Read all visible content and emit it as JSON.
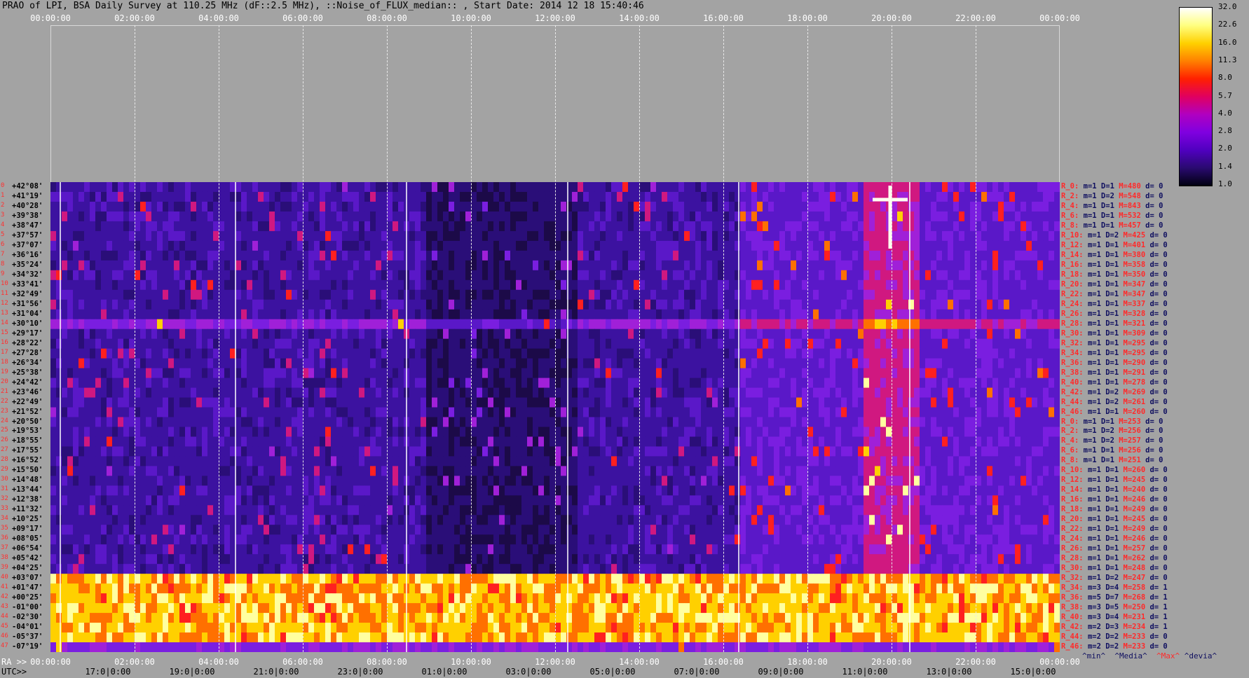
{
  "title": "PRAO of LPI, BSA Daily Survey at 110.25 MHz (dF::2.5 MHz), ::Noise_of_FLUX_median:: , Start Date: 2014 12 18 15:40:46",
  "top_axis": [
    "00:00:00",
    "02:00:00",
    "04:00:00",
    "06:00:00",
    "08:00:00",
    "10:00:00",
    "12:00:00",
    "14:00:00",
    "16:00:00",
    "18:00:00",
    "20:00:00",
    "22:00:00",
    "00:00:00"
  ],
  "bottom_axis": {
    "ra_prefix": "RA >>",
    "ra_labels": [
      "00:00:00",
      "02:00:00",
      "04:00:00",
      "06:00:00",
      "08:00:00",
      "10:00:00",
      "12:00:00",
      "14:00:00",
      "16:00:00",
      "18:00:00",
      "20:00:00",
      "22:00:00",
      "00:00:00"
    ],
    "utc_prefix": "UTC>>",
    "utc_labels": [
      "17:0|0:00",
      "19:0|0:00",
      "21:0|0:00",
      "23:0|0:00",
      "01:0|0:00",
      "03:0|0:00",
      "05:0|0:00",
      "07:0|0:00",
      "09:0|0:00",
      "11:0|0:00",
      "13:0|0:00",
      "15:0|0:00"
    ]
  },
  "colorbar": {
    "labels": [
      "32.0",
      "22.6",
      "16.0",
      "11.3",
      "8.0",
      "5.7",
      "4.0",
      "2.8",
      "2.0",
      "1.4",
      "1.0"
    ],
    "stops": [
      "#ffffff",
      "#ffff80",
      "#ffd000",
      "#ff8000",
      "#ff2000",
      "#e00060",
      "#b000c0",
      "#8000e0",
      "#5000c0",
      "#2a0a70",
      "#000010"
    ]
  },
  "dec_labels": [
    {
      "i": "0",
      "d": "+42°08'"
    },
    {
      "i": "1",
      "d": "+41°19'"
    },
    {
      "i": "2",
      "d": "+40°28'"
    },
    {
      "i": "3",
      "d": "+39°38'"
    },
    {
      "i": "4",
      "d": "+38°47'"
    },
    {
      "i": "5",
      "d": "+37°57'"
    },
    {
      "i": "6",
      "d": "+37°07'"
    },
    {
      "i": "7",
      "d": "+36°16'"
    },
    {
      "i": "8",
      "d": "+35°24'"
    },
    {
      "i": "9",
      "d": "+34°32'"
    },
    {
      "i": "10",
      "d": "+33°41'"
    },
    {
      "i": "11",
      "d": "+32°49'"
    },
    {
      "i": "12",
      "d": "+31°56'"
    },
    {
      "i": "13",
      "d": "+31°04'"
    },
    {
      "i": "14",
      "d": "+30°10'"
    },
    {
      "i": "15",
      "d": "+29°17'"
    },
    {
      "i": "16",
      "d": "+28°22'"
    },
    {
      "i": "17",
      "d": "+27°28'"
    },
    {
      "i": "18",
      "d": "+26°34'"
    },
    {
      "i": "19",
      "d": "+25°38'"
    },
    {
      "i": "20",
      "d": "+24°42'"
    },
    {
      "i": "21",
      "d": "+23°46'"
    },
    {
      "i": "22",
      "d": "+22°49'"
    },
    {
      "i": "23",
      "d": "+21°52'"
    },
    {
      "i": "24",
      "d": "+20°50'"
    },
    {
      "i": "25",
      "d": "+19°53'"
    },
    {
      "i": "26",
      "d": "+18°55'"
    },
    {
      "i": "27",
      "d": "+17°55'"
    },
    {
      "i": "28",
      "d": "+16°52'"
    },
    {
      "i": "29",
      "d": "+15°50'"
    },
    {
      "i": "30",
      "d": "+14°48'"
    },
    {
      "i": "31",
      "d": "+13°44'"
    },
    {
      "i": "32",
      "d": "+12°38'"
    },
    {
      "i": "33",
      "d": "+11°32'"
    },
    {
      "i": "34",
      "d": "+10°25'"
    },
    {
      "i": "35",
      "d": "+09°17'"
    },
    {
      "i": "36",
      "d": "+08°05'"
    },
    {
      "i": "37",
      "d": "+06°54'"
    },
    {
      "i": "38",
      "d": "+05°42'"
    },
    {
      "i": "39",
      "d": "+04°25'"
    },
    {
      "i": "40",
      "d": "+03°07'"
    },
    {
      "i": "41",
      "d": "+01°47'"
    },
    {
      "i": "42",
      "d": "+00°25'"
    },
    {
      "i": "43",
      "d": "-01°00'"
    },
    {
      "i": "44",
      "d": "-02°30'"
    },
    {
      "i": "45",
      "d": "-04°01'"
    },
    {
      "i": "46",
      "d": "-05°37'"
    },
    {
      "i": "47",
      "d": "-07°19'"
    }
  ],
  "right_stats": [
    {
      "r": "R_0:",
      "m": "m=1",
      "D": "D=1",
      "M": "M=480",
      "d": "d= 0"
    },
    {
      "r": "R_2:",
      "m": "m=1",
      "D": "D=2",
      "M": "M=548",
      "d": "d= 0"
    },
    {
      "r": "R_4:",
      "m": "m=1",
      "D": "D=1",
      "M": "M=843",
      "d": "d= 0"
    },
    {
      "r": "R_6:",
      "m": "m=1",
      "D": "D=1",
      "M": "M=532",
      "d": "d= 0"
    },
    {
      "r": "R_8:",
      "m": "m=1",
      "D": "D=1",
      "M": "M=457",
      "d": "d= 0"
    },
    {
      "r": "R_10:",
      "m": "m=1",
      "D": "D=2",
      "M": "M=425",
      "d": "d= 0"
    },
    {
      "r": "R_12:",
      "m": "m=1",
      "D": "D=1",
      "M": "M=401",
      "d": "d= 0"
    },
    {
      "r": "R_14:",
      "m": "m=1",
      "D": "D=1",
      "M": "M=380",
      "d": "d= 0"
    },
    {
      "r": "R_16:",
      "m": "m=1",
      "D": "D=1",
      "M": "M=358",
      "d": "d= 0"
    },
    {
      "r": "R_18:",
      "m": "m=1",
      "D": "D=1",
      "M": "M=350",
      "d": "d= 0"
    },
    {
      "r": "R_20:",
      "m": "m=1",
      "D": "D=1",
      "M": "M=347",
      "d": "d= 0"
    },
    {
      "r": "R_22:",
      "m": "m=1",
      "D": "D=1",
      "M": "M=347",
      "d": "d= 0"
    },
    {
      "r": "R_24:",
      "m": "m=1",
      "D": "D=1",
      "M": "M=337",
      "d": "d= 0"
    },
    {
      "r": "R_26:",
      "m": "m=1",
      "D": "D=1",
      "M": "M=328",
      "d": "d= 0"
    },
    {
      "r": "R_28:",
      "m": "m=1",
      "D": "D=1",
      "M": "M=321",
      "d": "d= 0"
    },
    {
      "r": "R_30:",
      "m": "m=1",
      "D": "D=1",
      "M": "M=309",
      "d": "d= 0"
    },
    {
      "r": "R_32:",
      "m": "m=1",
      "D": "D=1",
      "M": "M=295",
      "d": "d= 0"
    },
    {
      "r": "R_34:",
      "m": "m=1",
      "D": "D=1",
      "M": "M=295",
      "d": "d= 0"
    },
    {
      "r": "R_36:",
      "m": "m=1",
      "D": "D=1",
      "M": "M=290",
      "d": "d= 0"
    },
    {
      "r": "R_38:",
      "m": "m=1",
      "D": "D=1",
      "M": "M=291",
      "d": "d= 0"
    },
    {
      "r": "R_40:",
      "m": "m=1",
      "D": "D=1",
      "M": "M=278",
      "d": "d= 0"
    },
    {
      "r": "R_42:",
      "m": "m=1",
      "D": "D=2",
      "M": "M=269",
      "d": "d= 0"
    },
    {
      "r": "R_44:",
      "m": "m=1",
      "D": "D=2",
      "M": "M=261",
      "d": "d= 0"
    },
    {
      "r": "R_46:",
      "m": "m=1",
      "D": "D=1",
      "M": "M=260",
      "d": "d= 0"
    },
    {
      "r": "R_0:",
      "m": "m=1",
      "D": "D=1",
      "M": "M=253",
      "d": "d= 0"
    },
    {
      "r": "R_2:",
      "m": "m=1",
      "D": "D=2",
      "M": "M=256",
      "d": "d= 0"
    },
    {
      "r": "R_4:",
      "m": "m=1",
      "D": "D=2",
      "M": "M=257",
      "d": "d= 0"
    },
    {
      "r": "R_6:",
      "m": "m=1",
      "D": "D=1",
      "M": "M=256",
      "d": "d= 0"
    },
    {
      "r": "R_8:",
      "m": "m=1",
      "D": "D=1",
      "M": "M=251",
      "d": "d= 0"
    },
    {
      "r": "R_10:",
      "m": "m=1",
      "D": "D=1",
      "M": "M=260",
      "d": "d= 0"
    },
    {
      "r": "R_12:",
      "m": "m=1",
      "D": "D=1",
      "M": "M=245",
      "d": "d= 0"
    },
    {
      "r": "R_14:",
      "m": "m=1",
      "D": "D=1",
      "M": "M=240",
      "d": "d= 0"
    },
    {
      "r": "R_16:",
      "m": "m=1",
      "D": "D=1",
      "M": "M=246",
      "d": "d= 0"
    },
    {
      "r": "R_18:",
      "m": "m=1",
      "D": "D=1",
      "M": "M=249",
      "d": "d= 0"
    },
    {
      "r": "R_20:",
      "m": "m=1",
      "D": "D=1",
      "M": "M=245",
      "d": "d= 0"
    },
    {
      "r": "R_22:",
      "m": "m=1",
      "D": "D=1",
      "M": "M=249",
      "d": "d= 0"
    },
    {
      "r": "R_24:",
      "m": "m=1",
      "D": "D=1",
      "M": "M=246",
      "d": "d= 0"
    },
    {
      "r": "R_26:",
      "m": "m=1",
      "D": "D=1",
      "M": "M=257",
      "d": "d= 0"
    },
    {
      "r": "R_28:",
      "m": "m=1",
      "D": "D=1",
      "M": "M=262",
      "d": "d= 0"
    },
    {
      "r": "R_30:",
      "m": "m=1",
      "D": "D=1",
      "M": "M=248",
      "d": "d= 0"
    },
    {
      "r": "R_32:",
      "m": "m=1",
      "D": "D=2",
      "M": "M=247",
      "d": "d= 0"
    },
    {
      "r": "R_34:",
      "m": "m=3",
      "D": "D=4",
      "M": "M=258",
      "d": "d= 1"
    },
    {
      "r": "R_36:",
      "m": "m=5",
      "D": "D=7",
      "M": "M=268",
      "d": "d= 1"
    },
    {
      "r": "R_38:",
      "m": "m=3",
      "D": "D=5",
      "M": "M=250",
      "d": "d= 1"
    },
    {
      "r": "R_40:",
      "m": "m=3",
      "D": "D=4",
      "M": "M=231",
      "d": "d= 1"
    },
    {
      "r": "R_42:",
      "m": "m=2",
      "D": "D=3",
      "M": "M=234",
      "d": "d= 1"
    },
    {
      "r": "R_44:",
      "m": "m=2",
      "D": "D=2",
      "M": "M=233",
      "d": "d= 0"
    },
    {
      "r": "R_46:",
      "m": "m=2",
      "D": "D=2",
      "M": "M=233",
      "d": "d= 0"
    }
  ],
  "footer": {
    "min": "^min^",
    "median": "^Media^",
    "max": "^Max^",
    "devia": "^devia^"
  },
  "chart_data": {
    "type": "heatmap",
    "title": "PRAO of LPI, BSA Daily Survey at 110.25 MHz (dF::2.5 MHz), ::Noise_of_FLUX_median:: , Start Date: 2014 12 18 15:40:46",
    "x_axis_top": "sidereal time 00:00:00 – 00:00:00 (24 h)",
    "y_axis": "declination +42°08' to -07°19' (48 beams)",
    "colorscale": "log, 1.0 to 32.0",
    "grid": true
  }
}
